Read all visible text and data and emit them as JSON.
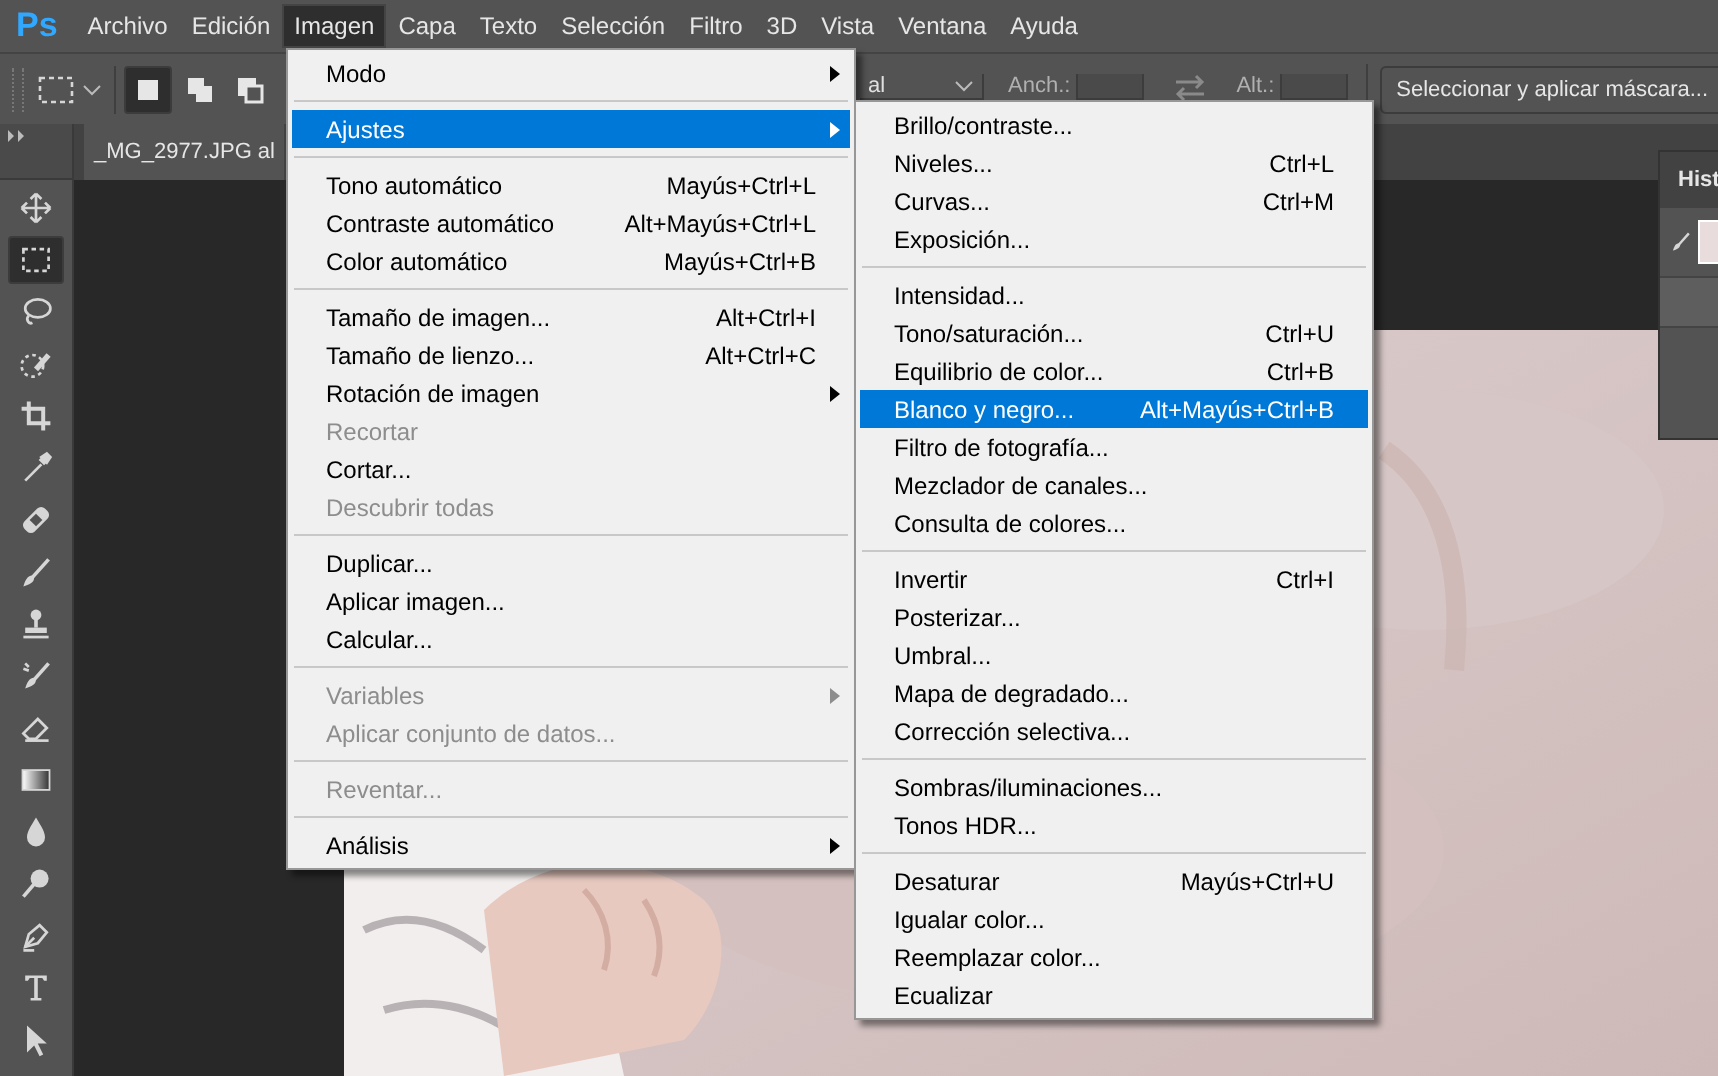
{
  "app": {
    "logo": "Ps"
  },
  "menu_bar": [
    {
      "label": "Archivo",
      "selected": false
    },
    {
      "label": "Edición",
      "selected": false
    },
    {
      "label": "Imagen",
      "selected": true
    },
    {
      "label": "Capa",
      "selected": false
    },
    {
      "label": "Texto",
      "selected": false
    },
    {
      "label": "Selección",
      "selected": false
    },
    {
      "label": "Filtro",
      "selected": false
    },
    {
      "label": "3D",
      "selected": false
    },
    {
      "label": "Vista",
      "selected": false
    },
    {
      "label": "Ventana",
      "selected": false
    },
    {
      "label": "Ayuda",
      "selected": false
    }
  ],
  "options_bar": {
    "selection_modes": [
      {
        "kind": "new",
        "selected": true
      },
      {
        "kind": "add",
        "selected": false
      },
      {
        "kind": "subtract",
        "selected": false
      }
    ],
    "style_value": "al",
    "width_label": "Anch.:",
    "height_label": "Alt.:",
    "mask_button": "Seleccionar y aplicar máscara..."
  },
  "document_tab": {
    "title": "_MG_2977.JPG al"
  },
  "tools": [
    {
      "kind": "move",
      "selected": false
    },
    {
      "kind": "marquee",
      "selected": true
    },
    {
      "kind": "lasso",
      "selected": false
    },
    {
      "kind": "quick-select",
      "selected": false
    },
    {
      "kind": "crop",
      "selected": false
    },
    {
      "kind": "eyedropper",
      "selected": false
    },
    {
      "kind": "healing",
      "selected": false
    },
    {
      "kind": "brush",
      "selected": false
    },
    {
      "kind": "stamp",
      "selected": false
    },
    {
      "kind": "history-brush",
      "selected": false
    },
    {
      "kind": "eraser",
      "selected": false
    },
    {
      "kind": "gradient",
      "selected": false
    },
    {
      "kind": "blur",
      "selected": false
    },
    {
      "kind": "dodge",
      "selected": false
    },
    {
      "kind": "pen",
      "selected": false
    },
    {
      "kind": "type",
      "selected": false
    },
    {
      "kind": "path-select",
      "selected": false
    }
  ],
  "history_panel": {
    "title": "Hist"
  },
  "image_menu": {
    "items": [
      {
        "kind": "item",
        "label": "Modo",
        "submenu": true,
        "disabled": false,
        "selected": false
      },
      {
        "kind": "separator"
      },
      {
        "kind": "item",
        "label": "Ajustes",
        "submenu": true,
        "disabled": false,
        "selected": true
      },
      {
        "kind": "separator"
      },
      {
        "kind": "item",
        "label": "Tono automático",
        "shortcut": "Mayús+Ctrl+L",
        "submenu": false,
        "disabled": false,
        "selected": false
      },
      {
        "kind": "item",
        "label": "Contraste automático",
        "shortcut": "Alt+Mayús+Ctrl+L",
        "submenu": false,
        "disabled": false,
        "selected": false
      },
      {
        "kind": "item",
        "label": "Color automático",
        "shortcut": "Mayús+Ctrl+B",
        "submenu": false,
        "disabled": false,
        "selected": false
      },
      {
        "kind": "separator"
      },
      {
        "kind": "item",
        "label": "Tamaño de imagen...",
        "shortcut": "Alt+Ctrl+I",
        "submenu": false,
        "disabled": false,
        "selected": false
      },
      {
        "kind": "item",
        "label": "Tamaño de lienzo...",
        "shortcut": "Alt+Ctrl+C",
        "submenu": false,
        "disabled": false,
        "selected": false
      },
      {
        "kind": "item",
        "label": "Rotación de imagen",
        "submenu": true,
        "disabled": false,
        "selected": false
      },
      {
        "kind": "item",
        "label": "Recortar",
        "submenu": false,
        "disabled": true,
        "selected": false
      },
      {
        "kind": "item",
        "label": "Cortar...",
        "submenu": false,
        "disabled": false,
        "selected": false
      },
      {
        "kind": "item",
        "label": "Descubrir todas",
        "submenu": false,
        "disabled": true,
        "selected": false
      },
      {
        "kind": "separator"
      },
      {
        "kind": "item",
        "label": "Duplicar...",
        "submenu": false,
        "disabled": false,
        "selected": false
      },
      {
        "kind": "item",
        "label": "Aplicar imagen...",
        "submenu": false,
        "disabled": false,
        "selected": false
      },
      {
        "kind": "item",
        "label": "Calcular...",
        "submenu": false,
        "disabled": false,
        "selected": false
      },
      {
        "kind": "separator"
      },
      {
        "kind": "item",
        "label": "Variables",
        "submenu": true,
        "disabled": true,
        "selected": false
      },
      {
        "kind": "item",
        "label": "Aplicar conjunto de datos...",
        "submenu": false,
        "disabled": true,
        "selected": false
      },
      {
        "kind": "separator"
      },
      {
        "kind": "item",
        "label": "Reventar...",
        "submenu": false,
        "disabled": true,
        "selected": false
      },
      {
        "kind": "separator"
      },
      {
        "kind": "item",
        "label": "Análisis",
        "submenu": true,
        "disabled": false,
        "selected": false
      }
    ]
  },
  "adjustments_menu": {
    "items": [
      {
        "kind": "item",
        "label": "Brillo/contraste...",
        "submenu": false,
        "disabled": false,
        "selected": false
      },
      {
        "kind": "item",
        "label": "Niveles...",
        "shortcut": "Ctrl+L",
        "submenu": false,
        "disabled": false,
        "selected": false
      },
      {
        "kind": "item",
        "label": "Curvas...",
        "shortcut": "Ctrl+M",
        "submenu": false,
        "disabled": false,
        "selected": false
      },
      {
        "kind": "item",
        "label": "Exposición...",
        "submenu": false,
        "disabled": false,
        "selected": false
      },
      {
        "kind": "separator"
      },
      {
        "kind": "item",
        "label": "Intensidad...",
        "submenu": false,
        "disabled": false,
        "selected": false
      },
      {
        "kind": "item",
        "label": "Tono/saturación...",
        "shortcut": "Ctrl+U",
        "submenu": false,
        "disabled": false,
        "selected": false
      },
      {
        "kind": "item",
        "label": "Equilibrio de color...",
        "shortcut": "Ctrl+B",
        "submenu": false,
        "disabled": false,
        "selected": false
      },
      {
        "kind": "item",
        "label": "Blanco y negro...",
        "shortcut": "Alt+Mayús+Ctrl+B",
        "submenu": false,
        "disabled": false,
        "selected": true
      },
      {
        "kind": "item",
        "label": "Filtro de fotografía...",
        "submenu": false,
        "disabled": false,
        "selected": false
      },
      {
        "kind": "item",
        "label": "Mezclador de canales...",
        "submenu": false,
        "disabled": false,
        "selected": false
      },
      {
        "kind": "item",
        "label": "Consulta de colores...",
        "submenu": false,
        "disabled": false,
        "selected": false
      },
      {
        "kind": "separator"
      },
      {
        "kind": "item",
        "label": "Invertir",
        "shortcut": "Ctrl+I",
        "submenu": false,
        "disabled": false,
        "selected": false
      },
      {
        "kind": "item",
        "label": "Posterizar...",
        "submenu": false,
        "disabled": false,
        "selected": false
      },
      {
        "kind": "item",
        "label": "Umbral...",
        "submenu": false,
        "disabled": false,
        "selected": false
      },
      {
        "kind": "item",
        "label": "Mapa de degradado...",
        "submenu": false,
        "disabled": false,
        "selected": false
      },
      {
        "kind": "item",
        "label": "Corrección selectiva...",
        "submenu": false,
        "disabled": false,
        "selected": false
      },
      {
        "kind": "separator"
      },
      {
        "kind": "item",
        "label": "Sombras/iluminaciones...",
        "submenu": false,
        "disabled": false,
        "selected": false
      },
      {
        "kind": "item",
        "label": "Tonos HDR...",
        "submenu": false,
        "disabled": false,
        "selected": false
      },
      {
        "kind": "separator"
      },
      {
        "kind": "item",
        "label": "Desaturar",
        "shortcut": "Mayús+Ctrl+U",
        "submenu": false,
        "disabled": false,
        "selected": false
      },
      {
        "kind": "item",
        "label": "Igualar color...",
        "submenu": false,
        "disabled": false,
        "selected": false
      },
      {
        "kind": "item",
        "label": "Reemplazar color...",
        "submenu": false,
        "disabled": false,
        "selected": false
      },
      {
        "kind": "item",
        "label": "Ecualizar",
        "submenu": false,
        "disabled": false,
        "selected": false
      }
    ]
  }
}
